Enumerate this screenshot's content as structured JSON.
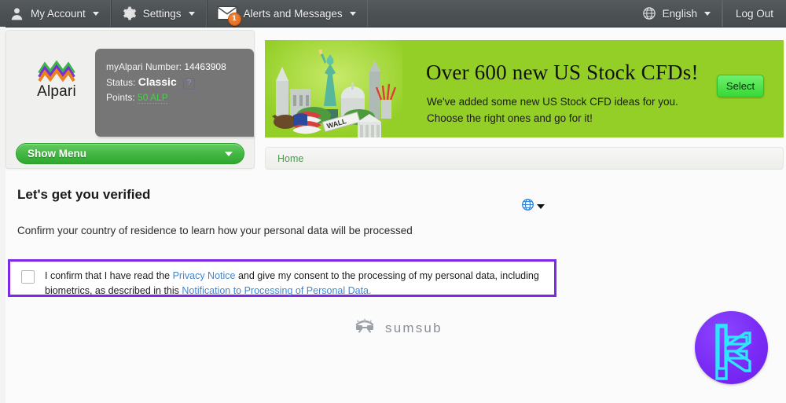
{
  "topbar": {
    "items": [
      {
        "label": "My Account",
        "icon": "user-icon"
      },
      {
        "label": "Settings",
        "icon": "gear-icon"
      },
      {
        "label": "Alerts and Messages",
        "icon": "mail-icon",
        "badge": "1"
      }
    ],
    "language": "English",
    "language_icon": "globe-icon",
    "logout": "Log Out"
  },
  "account": {
    "brand": "Alpari",
    "brand_icon": "alpari-logo-icon",
    "number_label": "myAlpari Number:",
    "number_value": "14463908",
    "status_label": "Status:",
    "status_value": "Classic",
    "help_icon": "question-mark-icon",
    "points_label": "Points:",
    "points_value": "50 ALP",
    "menu_button": "Show Menu",
    "menu_caret_icon": "chevron-down-icon"
  },
  "banner": {
    "title": "Over 600 new US Stock CFDs!",
    "line1": "We've added some new US Stock CFD ideas for you.",
    "line2": "Choose the right ones and go for it!",
    "button": "Select",
    "art_icon": "us-landmarks-collage",
    "background_color": "#93cf26"
  },
  "breadcrumb": {
    "home": "Home"
  },
  "main": {
    "title": "Let's get you verified",
    "subtitle": "Confirm your country of residence to learn how your personal data will be processed",
    "language_selector_icon": "globe-icon",
    "language_caret_icon": "chevron-down-icon",
    "consent": {
      "text_part1": "I confirm that I have read the ",
      "link1": "Privacy Notice",
      "text_part2": " and give my consent to the processing of my personal data, including biometrics, as described in this ",
      "link2": "Notification to Processing of Personal Data.",
      "checked": false,
      "highlight_color": "#7c2ae8",
      "link_color": "#3f86d2"
    },
    "footer_logo": "sumsub",
    "footer_logo_icon": "sumsub-mark-icon"
  },
  "floating_badge": {
    "icon": "monogram-c-icon",
    "circle_color": "#7a2bf5",
    "glyph_color": "#2fe6ff"
  }
}
